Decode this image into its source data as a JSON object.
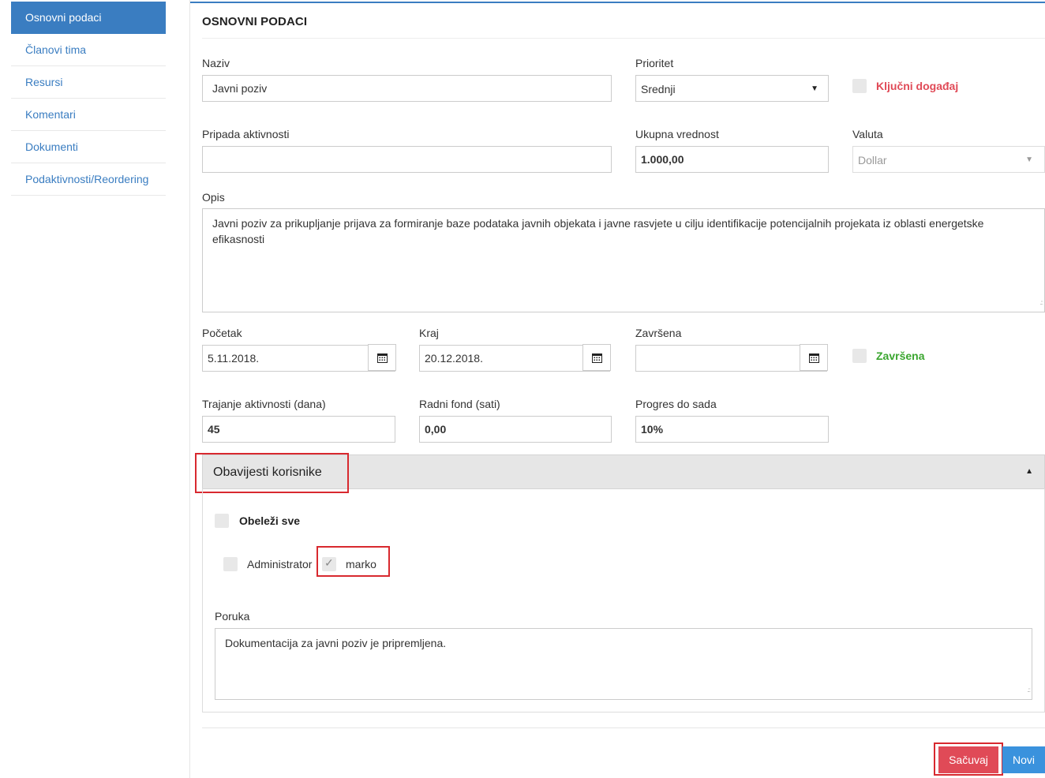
{
  "sidebar": {
    "items": [
      {
        "label": "Osnovni podaci"
      },
      {
        "label": "Članovi tima"
      },
      {
        "label": "Resursi"
      },
      {
        "label": "Komentari"
      },
      {
        "label": "Dokumenti"
      },
      {
        "label": "Podaktivnosti/Reordering"
      }
    ]
  },
  "section": {
    "title": "OSNOVNI PODACI"
  },
  "form": {
    "naziv_label": "Naziv",
    "naziv_value": "Javni poziv",
    "prioritet_label": "Prioritet",
    "prioritet_value": "Srednji",
    "kljucni_label": "Ključni događaj",
    "pripada_label": "Pripada aktivnosti",
    "pripada_value": "",
    "ukupna_label": "Ukupna vrednost",
    "ukupna_value": "1.000,00",
    "valuta_label": "Valuta",
    "valuta_value": "Dollar",
    "opis_label": "Opis",
    "opis_value": "Javni poziv za prikupljanje prijava za formiranje baze podataka javnih objekata i javne rasvjete u cilju identifikacije potencijalnih projekata iz oblasti energetske efikasnosti",
    "pocetak_label": "Početak",
    "pocetak_value": "5.11.2018.",
    "kraj_label": "Kraj",
    "kraj_value": "20.12.2018.",
    "zavrsena_label": "Završena",
    "zavrsena_value": "",
    "zavrsena_cb_label": "Završena",
    "trajanje_label": "Trajanje aktivnosti (dana)",
    "trajanje_value": "45",
    "radni_label": "Radni fond (sati)",
    "radni_value": "0,00",
    "progres_label": "Progres do sada",
    "progres_value": "10%"
  },
  "notify": {
    "title": "Obavijesti korisnike",
    "select_all_label": "Obeleži sve",
    "users": [
      {
        "label": "Administrator",
        "checked": false
      },
      {
        "label": "marko",
        "checked": true
      }
    ],
    "poruka_label": "Poruka",
    "poruka_value": "Dokumentacija za javni poziv je pripremljena."
  },
  "buttons": {
    "save": "Sačuvaj",
    "new": "Novi"
  },
  "colors": {
    "accent": "#3a7dc1",
    "danger": "#e04a57",
    "success": "#3aa62f",
    "highlight": "#d8292f"
  }
}
